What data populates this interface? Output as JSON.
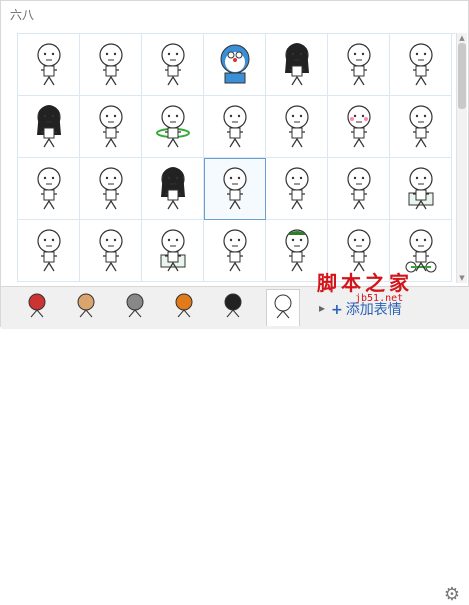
{
  "panel": {
    "title": "六八"
  },
  "grid": {
    "rows": 4,
    "cols": 7,
    "selected_index": 17,
    "stickers": [
      "stickman-standing",
      "stickman-drinking",
      "stickman-lying",
      "doraemon-cat",
      "girl-black-hair",
      "stickman-eating",
      "stickman-sitting",
      "long-hair-ghost",
      "stickman-frying-pan",
      "stickman-hula-hoop",
      "stickman-blank",
      "stickman-kissing",
      "stickman-blushing",
      "stickman-hands-on-hips",
      "stickman-pointing",
      "stickman-dancing",
      "long-hair-girl",
      "stickman-crouching",
      "stickman-shocked",
      "stickman-walking",
      "stickman-sitting-box",
      "stickman-singing",
      "stickman-dragging",
      "stickman-holding-sign",
      "stickman-cheering",
      "stickman-hat",
      "stickman-waving",
      "stickman-motorbike"
    ]
  },
  "tabs": [
    {
      "name": "monkey-king-tab",
      "active": false
    },
    {
      "name": "bald-man-tab",
      "active": false
    },
    {
      "name": "crab-tab",
      "active": false
    },
    {
      "name": "lion-tab",
      "active": false
    },
    {
      "name": "panda-tab",
      "active": false
    },
    {
      "name": "stickman-tab",
      "active": true
    }
  ],
  "bottom": {
    "add_label": "添加表情",
    "arrow": "▸"
  },
  "watermark": {
    "text": "脚本之家",
    "url": "jb51.net"
  },
  "colors": {
    "grid_line": "#dbe7f1",
    "selected": "#6aa0cf",
    "link": "#2a62b8",
    "watermark": "#d2141b"
  }
}
